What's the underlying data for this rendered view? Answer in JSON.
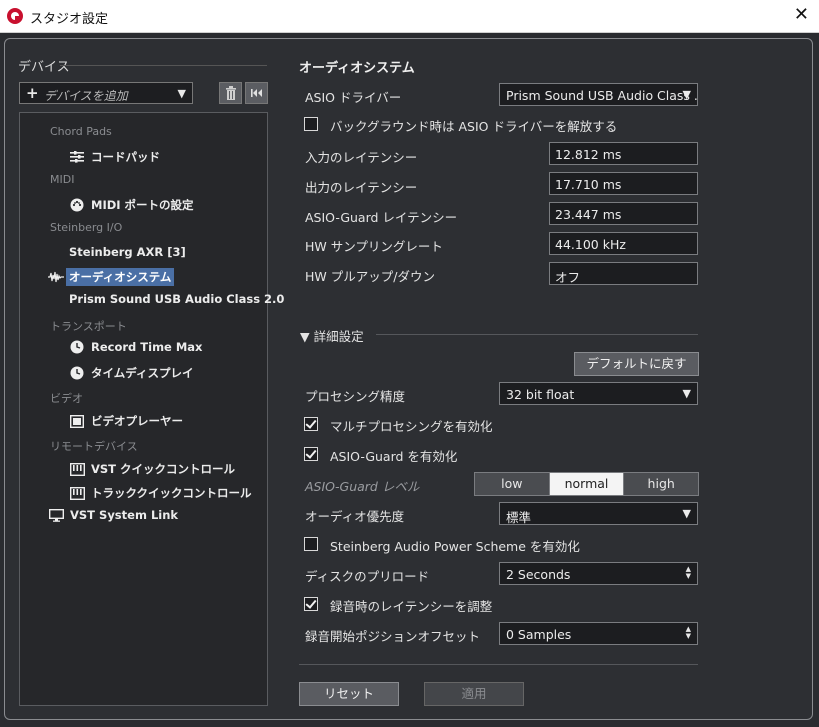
{
  "window": {
    "title": "スタジオ設定",
    "close": "✕"
  },
  "left": {
    "title": "デバイス",
    "add_device": "デバイスを追加",
    "tree": {
      "cat_chord_pads": "Chord Pads",
      "chord_pad": "コードパッド",
      "cat_midi": "MIDI",
      "midi_port": "MIDI ポートの設定",
      "cat_steinberg_io": "Steinberg I/O",
      "steinberg_axr": "Steinberg AXR [3]",
      "audio_system": "オーディオシステム",
      "prism_sound": "Prism Sound USB Audio Class 2.0",
      "cat_transport": "トランスポート",
      "record_time_max": "Record Time Max",
      "time_display": "タイムディスプレイ",
      "cat_video": "ビデオ",
      "video_player": "ビデオプレーヤー",
      "cat_remote": "リモートデバイス",
      "vst_quick": "VST クイックコントロール",
      "track_quick": "トラッククイックコントロール",
      "vst_system_link": "VST System Link"
    }
  },
  "right": {
    "title": "オーディオシステム",
    "asio_driver_label": "ASIO ドライバー",
    "asio_driver_value": "Prism Sound USB Audio Class .",
    "release_driver": "バックグラウンド時は ASIO ドライバーを解放する",
    "input_latency_label": "入力のレイテンシー",
    "input_latency": "12.812 ms",
    "output_latency_label": "出力のレイテンシー",
    "output_latency": "17.710 ms",
    "asio_guard_latency_label": "ASIO-Guard レイテンシー",
    "asio_guard_latency": "23.447 ms",
    "hw_sample_rate_label": "HW サンプリングレート",
    "hw_sample_rate": "44.100 kHz",
    "hw_pullup_label": "HW プルアップ/ダウン",
    "hw_pullup": "オフ",
    "advanced": "▼ 詳細設定",
    "reset_default": "デフォルトに戻す",
    "precision_label": "プロセシング精度",
    "precision": "32 bit float",
    "multiprocessing": "マルチプロセシングを有効化",
    "asio_guard_enable": "ASIO-Guard を有効化",
    "asio_guard_level_label": "ASIO-Guard レベル",
    "levels": [
      "low",
      "normal",
      "high"
    ],
    "audio_priority_label": "オーディオ優先度",
    "audio_priority": "標準",
    "power_scheme": "Steinberg Audio Power Scheme を有効化",
    "disk_preload_label": "ディスクのプリロード",
    "disk_preload": "2 Seconds",
    "adjust_latency": "録音時のレイテンシーを調整",
    "record_offset_label": "録音開始ポジションオフセット",
    "record_offset": "0 Samples",
    "reset": "リセット",
    "apply": "適用"
  },
  "colors": {
    "accent": "#4a6fa5",
    "panel": "#2d2f33",
    "field": "#1c1d20",
    "logo": "#c8102e"
  },
  "state": {
    "multiprocessing": true,
    "asio_guard": true,
    "release_driver": false,
    "power_scheme": false,
    "adjust_latency": true,
    "asio_guard_level": "normal"
  }
}
